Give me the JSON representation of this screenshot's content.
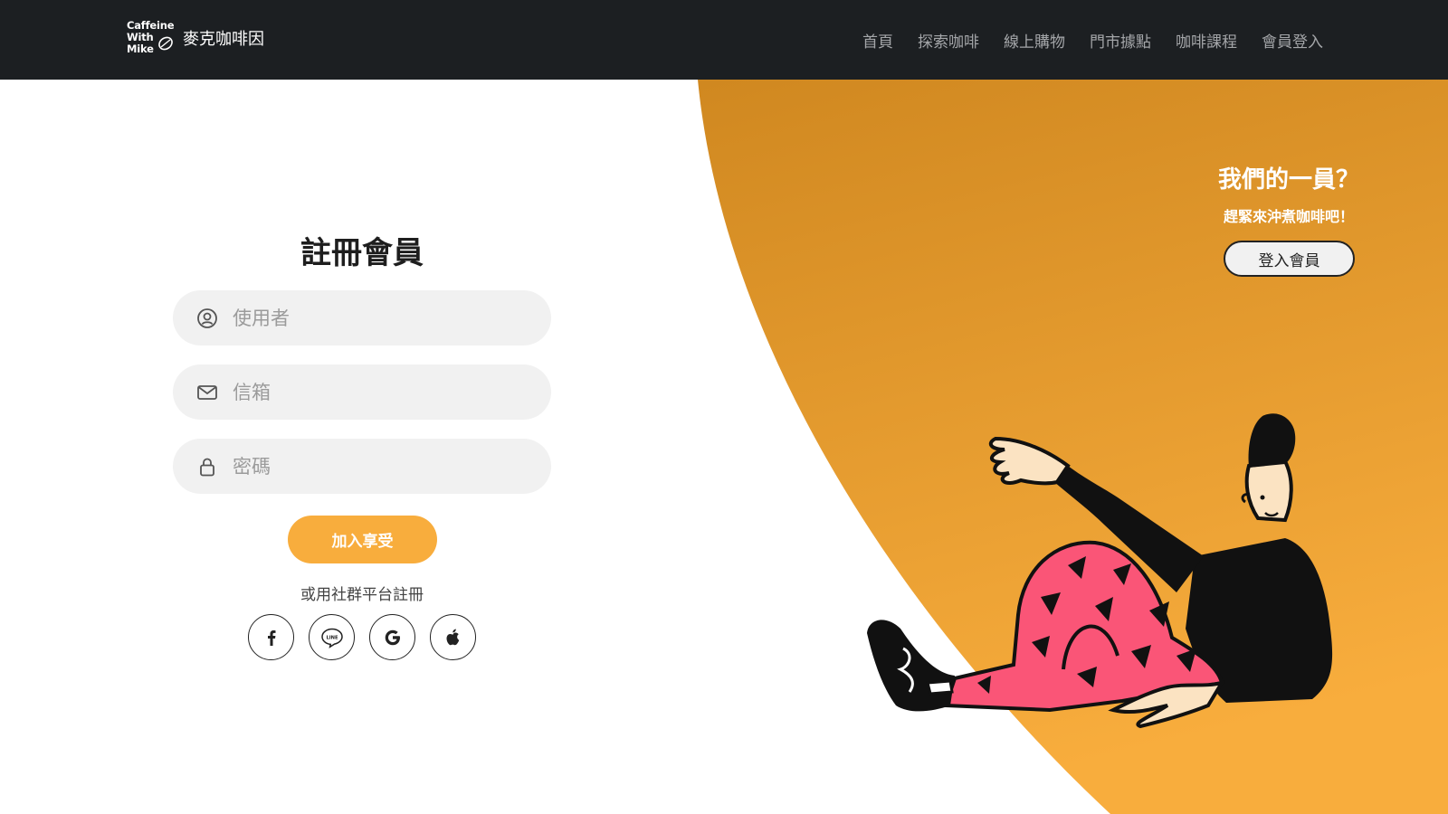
{
  "nav": {
    "logo_text": "Caffeine\nWith\nMike",
    "brand_name": "麥克咖啡因",
    "links": [
      "首頁",
      "探索咖啡",
      "線上購物",
      "門市據點",
      "咖啡課程",
      "會員登入"
    ]
  },
  "signup": {
    "title": "註冊會員",
    "fields": {
      "username": {
        "placeholder": "使用者",
        "value": "",
        "icon": "user-circle-icon"
      },
      "email": {
        "placeholder": "信箱",
        "value": "",
        "icon": "envelope-icon"
      },
      "password": {
        "placeholder": "密碼",
        "value": "",
        "icon": "lock-icon"
      }
    },
    "submit_label": "加入享受",
    "social_caption": "或用社群平台註冊",
    "social": [
      {
        "name": "facebook",
        "icon": "facebook-icon"
      },
      {
        "name": "line",
        "icon": "line-icon",
        "text": "LINE"
      },
      {
        "name": "google",
        "icon": "google-icon"
      },
      {
        "name": "apple",
        "icon": "apple-icon"
      }
    ]
  },
  "panel": {
    "title": "我們的一員？",
    "subtitle": "趕緊來沖煮咖啡吧！",
    "login_label": "登入會員",
    "illustration": "sitting-person-illustration"
  },
  "colors": {
    "navbar": "#1c1f22",
    "nav_link": "#a4a6a9",
    "accent": "#f8ad3d",
    "orange_dark": "#d08820",
    "orange_light": "#f8ad3d",
    "field_bg": "#f1f1f1",
    "pants": "#fa5577"
  }
}
